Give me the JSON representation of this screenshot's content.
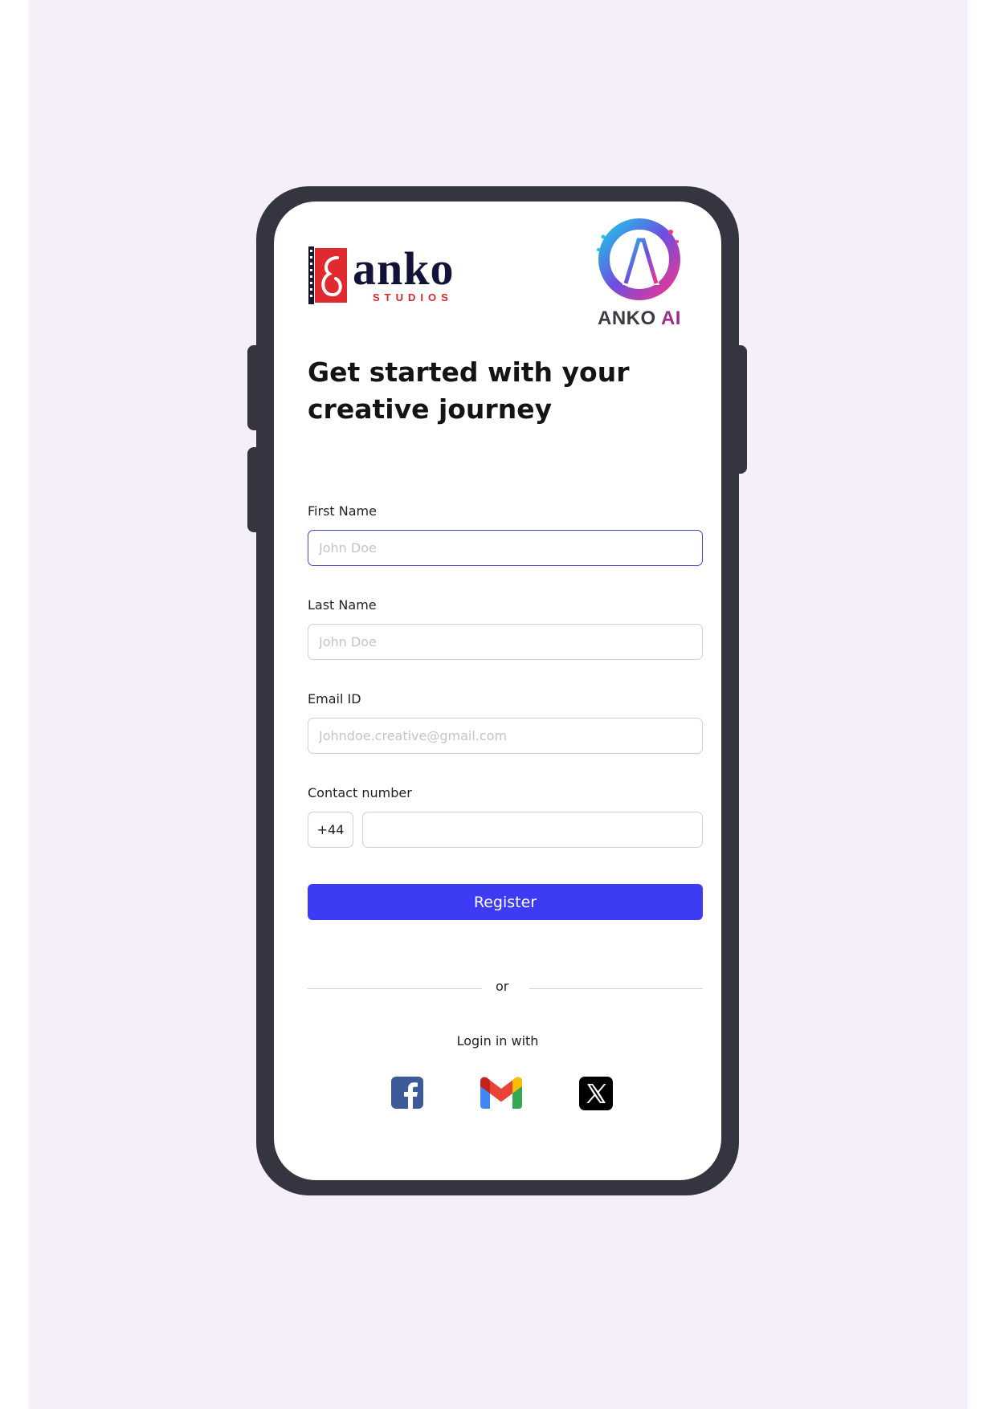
{
  "brand": {
    "studios_name": "anko",
    "studios_sub": "STUDIOS",
    "ai_name_1": "ANKO",
    "ai_name_2": "AI"
  },
  "header": {
    "title": "Get started with your creative journey"
  },
  "form": {
    "first_name": {
      "label": "First Name",
      "placeholder": "John Doe",
      "value": ""
    },
    "last_name": {
      "label": "Last Name",
      "placeholder": "John Doe",
      "value": ""
    },
    "email": {
      "label": "Email ID",
      "placeholder": "Johndoe.creative@gmail.com",
      "value": ""
    },
    "contact": {
      "label": "Contact number",
      "country_code": "+44",
      "value": ""
    },
    "register_label": "Register"
  },
  "divider": {
    "text": "or"
  },
  "social": {
    "heading": "Login in with",
    "providers": [
      {
        "name": "Facebook",
        "icon": "facebook-icon",
        "color": "#3d5a98"
      },
      {
        "name": "Gmail",
        "icon": "gmail-icon",
        "color": "#ea4335"
      },
      {
        "name": "X",
        "icon": "x-icon",
        "color": "#000000"
      }
    ]
  },
  "colors": {
    "accent": "#3d3bf3",
    "focus_border": "#4646c8",
    "page_background": "#f5eff9",
    "phone_frame": "#353542"
  }
}
